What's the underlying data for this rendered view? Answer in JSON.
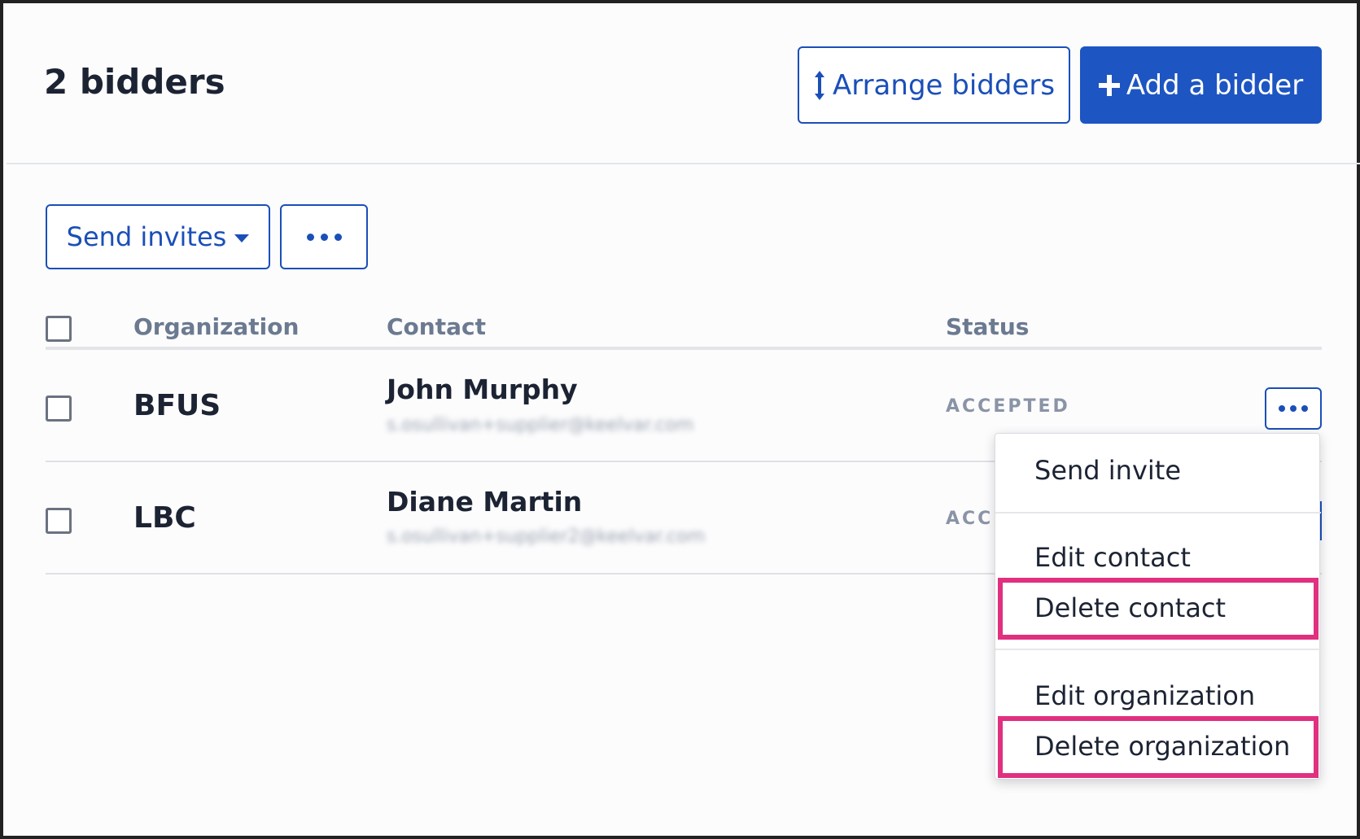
{
  "header": {
    "title": "2 bidders",
    "arrange_label": "Arrange bidders",
    "add_label": "Add a bidder"
  },
  "toolbar": {
    "send_invites_label": "Send invites"
  },
  "table": {
    "columns": [
      "Organization",
      "Contact",
      "Status"
    ],
    "rows": [
      {
        "organization": "BFUS",
        "contact_name": "John Murphy",
        "contact_email": "s.osullivan+supplier@keelvar.com",
        "status": "ACCEPTED"
      },
      {
        "organization": "LBC",
        "contact_name": "Diane Martin",
        "contact_email": "s.osullivan+supplier2@keelvar.com",
        "status": "ACCI"
      }
    ]
  },
  "menu": {
    "items": [
      "Send invite",
      "Edit contact",
      "Delete contact",
      "Edit organization",
      "Delete organization"
    ],
    "highlighted": [
      "Delete contact",
      "Delete organization"
    ]
  },
  "colors": {
    "primary": "#1d55c2",
    "highlight": "#e0307f",
    "status": "#8a94a6"
  },
  "icons": {
    "arrange": "vertical-arrows-icon",
    "add": "plus-icon",
    "more": "more-dots-icon",
    "dropdown": "caret-down-icon"
  }
}
